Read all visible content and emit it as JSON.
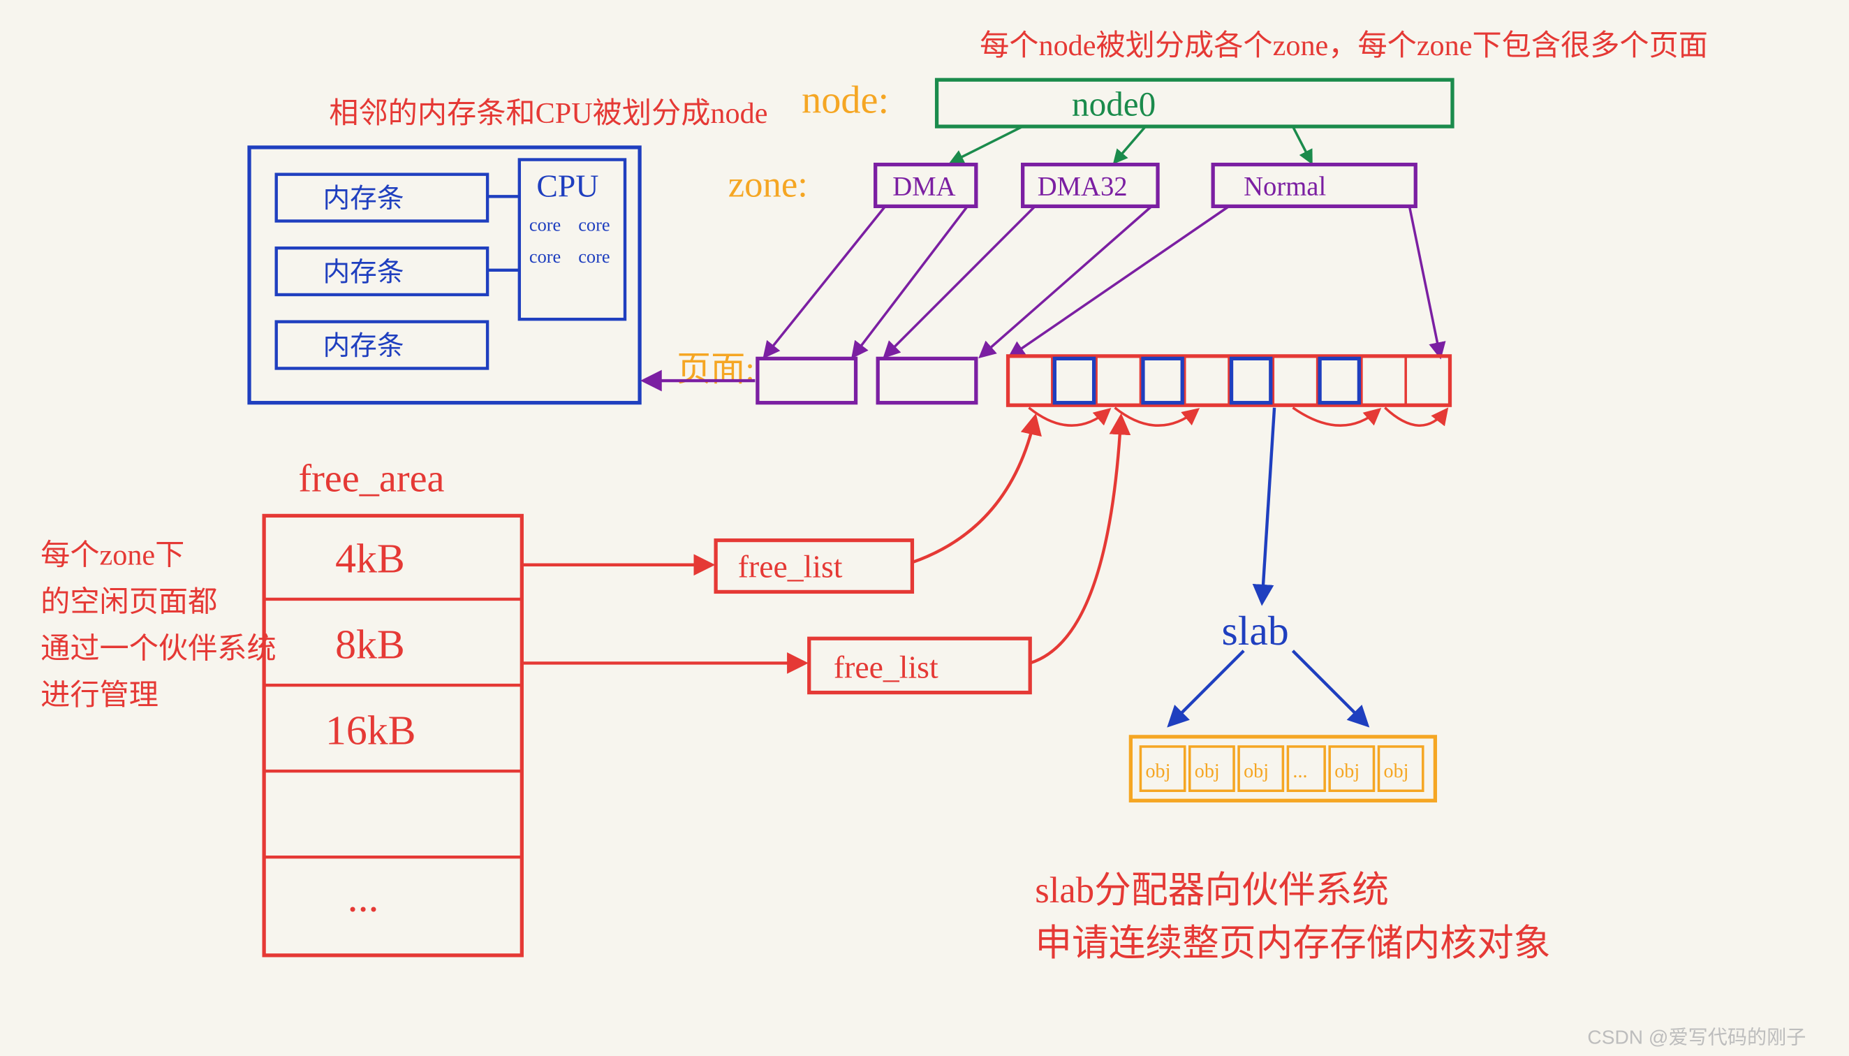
{
  "colors": {
    "red": "#e53935",
    "blue": "#1f3fbf",
    "orange": "#f5a623",
    "green": "#1b8b4c",
    "purple": "#7b1fa2",
    "black": "#333333"
  },
  "annotations": {
    "topRed": "相邻的内存条和CPU被划分成node",
    "topRightRed": "每个node被划分成各个zone，每个zone下包含很多个页面",
    "leftRed1": "每个zone下",
    "leftRed2": "的空闲页面都",
    "leftRed3": "通过一个伙伴系统",
    "leftRed4": "进行管理",
    "bottomRed1": "slab分配器向伙伴系统",
    "bottomRed2": "申请连续整页内存存储内核对象",
    "watermark": "CSDN @爱写代码的刚子"
  },
  "labels": {
    "node": "node:",
    "zone": "zone:",
    "page": "页面:",
    "freeArea": "free_area",
    "slab": "slab"
  },
  "nodeBox": {
    "title": "node0"
  },
  "zones": [
    "DMA",
    "DMA32",
    "Normal"
  ],
  "cpu": {
    "title": "CPU",
    "cores": [
      "core",
      "core",
      "core",
      "core"
    ],
    "mem": [
      "内存条",
      "内存条",
      "内存条"
    ]
  },
  "freeArea": {
    "rows": [
      "4kB",
      "8kB",
      "16kB",
      "",
      "..."
    ]
  },
  "freeLists": [
    "free_list",
    "free_list"
  ],
  "slabObjs": [
    "obj",
    "obj",
    "obj",
    "...",
    "obj",
    "obj"
  ]
}
